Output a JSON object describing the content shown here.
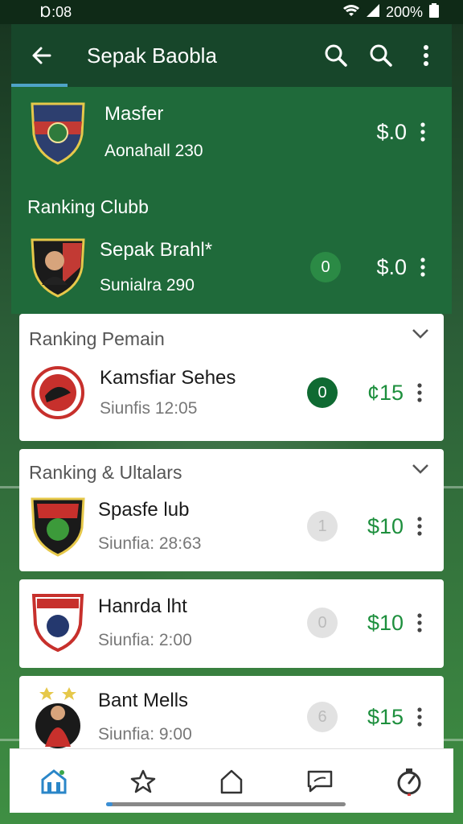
{
  "status_bar": {
    "time": "Ɒ:08",
    "battery": "200%"
  },
  "app_bar": {
    "title": "Sepak Baobla"
  },
  "hero": {
    "top_item": {
      "name": "Masfer",
      "sub": "Aonahall 230",
      "price": "$.0"
    },
    "section_title": "Ranking Clubb",
    "second_item": {
      "name": "Sepak Brahl*",
      "sub": "Sunialra 290",
      "badge": "0",
      "price": "$.0"
    }
  },
  "sections": [
    {
      "title": "Ranking Pemain",
      "name": "Kamsfiar Sehes",
      "sub": "Siunfis 12:05",
      "badge": "0",
      "price": "¢15"
    }
  ],
  "cards": [
    {
      "section_title": "Ranking & Ultalars",
      "name": "Spasfe lub",
      "sub": "Siunfia: 28:63",
      "badge": "1",
      "price": "$10"
    },
    {
      "name": "Hanrda lht",
      "sub": "Siunfia: 2:00",
      "badge": "0",
      "price": "$10"
    },
    {
      "name": "Bant Mells",
      "sub": "Siunfia: 9:00",
      "badge": "6",
      "price": "$15"
    }
  ],
  "colors": {
    "primary": "#1f6a3a",
    "accent_green": "#1d8f3d",
    "header": "#17462a"
  }
}
